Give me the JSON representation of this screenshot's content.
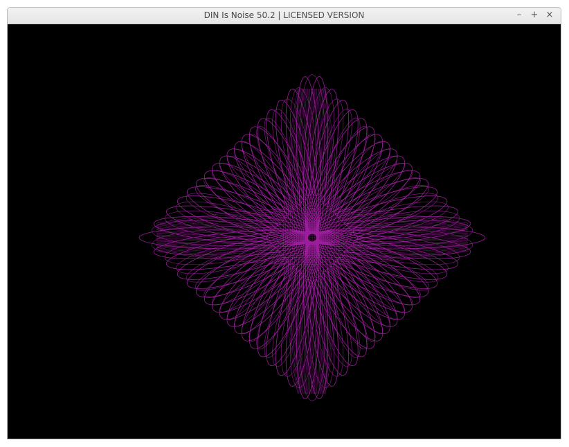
{
  "window": {
    "title": "DIN Is Noise 50.2 | LICENSED VERSION",
    "controls": {
      "minimize": "–",
      "maximize": "+",
      "close": "×"
    }
  },
  "visual": {
    "background": "#000000",
    "curve_color": "#b022b0",
    "pattern": "spirograph-rose"
  }
}
